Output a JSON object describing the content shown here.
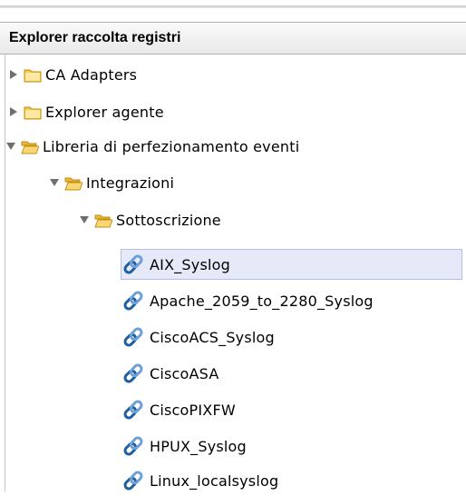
{
  "panel": {
    "title": "Explorer raccolta registri"
  },
  "tree": {
    "nodes": [
      {
        "label": "CA Adapters",
        "type": "folder",
        "state": "collapsed",
        "depth": 0
      },
      {
        "label": "Explorer agente",
        "type": "folder",
        "state": "collapsed",
        "depth": 0
      },
      {
        "label": "Libreria di perfezionamento eventi",
        "type": "folder",
        "state": "expanded",
        "depth": 0
      },
      {
        "label": "Integrazioni",
        "type": "folder",
        "state": "expanded",
        "depth": 1
      },
      {
        "label": "Sottoscrizione",
        "type": "folder",
        "state": "expanded",
        "depth": 2
      },
      {
        "label": "AIX_Syslog",
        "type": "integration",
        "state": "selected",
        "depth": 3
      },
      {
        "label": "Apache_2059_to_2280_Syslog",
        "type": "integration",
        "depth": 3
      },
      {
        "label": "CiscoACS_Syslog",
        "type": "integration",
        "depth": 3
      },
      {
        "label": "CiscoASA",
        "type": "integration",
        "depth": 3
      },
      {
        "label": "CiscoPIXFW",
        "type": "integration",
        "depth": 3
      },
      {
        "label": "HPUX_Syslog",
        "type": "integration",
        "depth": 3
      },
      {
        "label": "Linux_localsyslog",
        "type": "integration",
        "depth": 3
      }
    ]
  },
  "icons": {
    "collapsed": "triangle-right-icon",
    "expanded": "triangle-down-icon",
    "folder": "folder-icon",
    "folder_open": "open-folder-icon",
    "integration": "chain-link-icon"
  },
  "colors": {
    "folder_yellow": "#f5c84b",
    "folder_outline": "#c48f15",
    "link_blue": "#1f5f9e",
    "arrow_gray": "#6f6f6f",
    "selection": "#e6e9f8"
  }
}
